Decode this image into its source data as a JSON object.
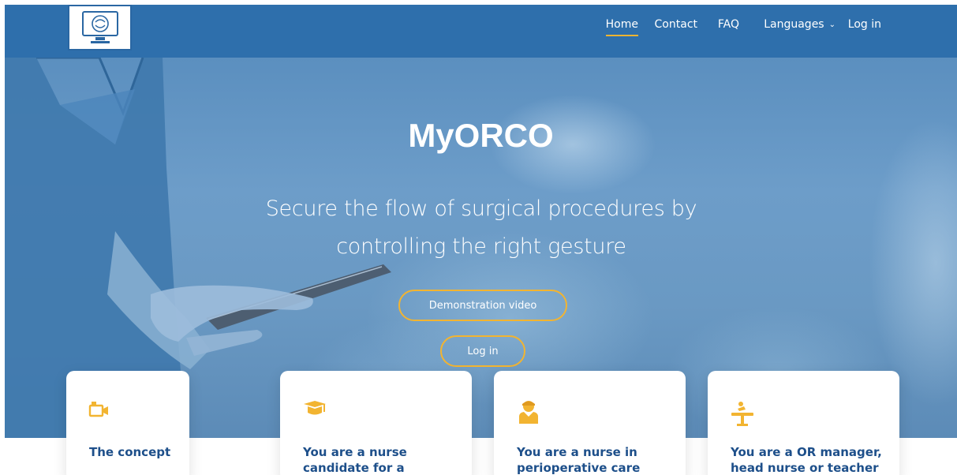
{
  "nav": {
    "items": [
      {
        "label": "Home",
        "active": true
      },
      {
        "label": "Contact"
      },
      {
        "label": "FAQ"
      },
      {
        "label": "Languages",
        "icon": "chevron-down-icon"
      },
      {
        "label": "Log in"
      }
    ]
  },
  "hero": {
    "title": "MyORCO",
    "subtitle": "Secure the flow of surgical procedures by controlling the right gesture",
    "demo_button": "Demonstration video",
    "login_button": "Log in"
  },
  "cards": [
    {
      "icon": "video-camera-icon",
      "title": "The concept"
    },
    {
      "icon": "graduation-cap-icon",
      "title": "You are a nurse candidate for a"
    },
    {
      "icon": "nurse-icon",
      "title": "You are a nurse in perioperative care"
    },
    {
      "icon": "operating-table-icon",
      "title": "You are a OR manager, head nurse or teacher"
    }
  ],
  "colors": {
    "navbar": "#2e6fac",
    "accent": "#f2b431",
    "card_title": "#1d4f8a"
  }
}
